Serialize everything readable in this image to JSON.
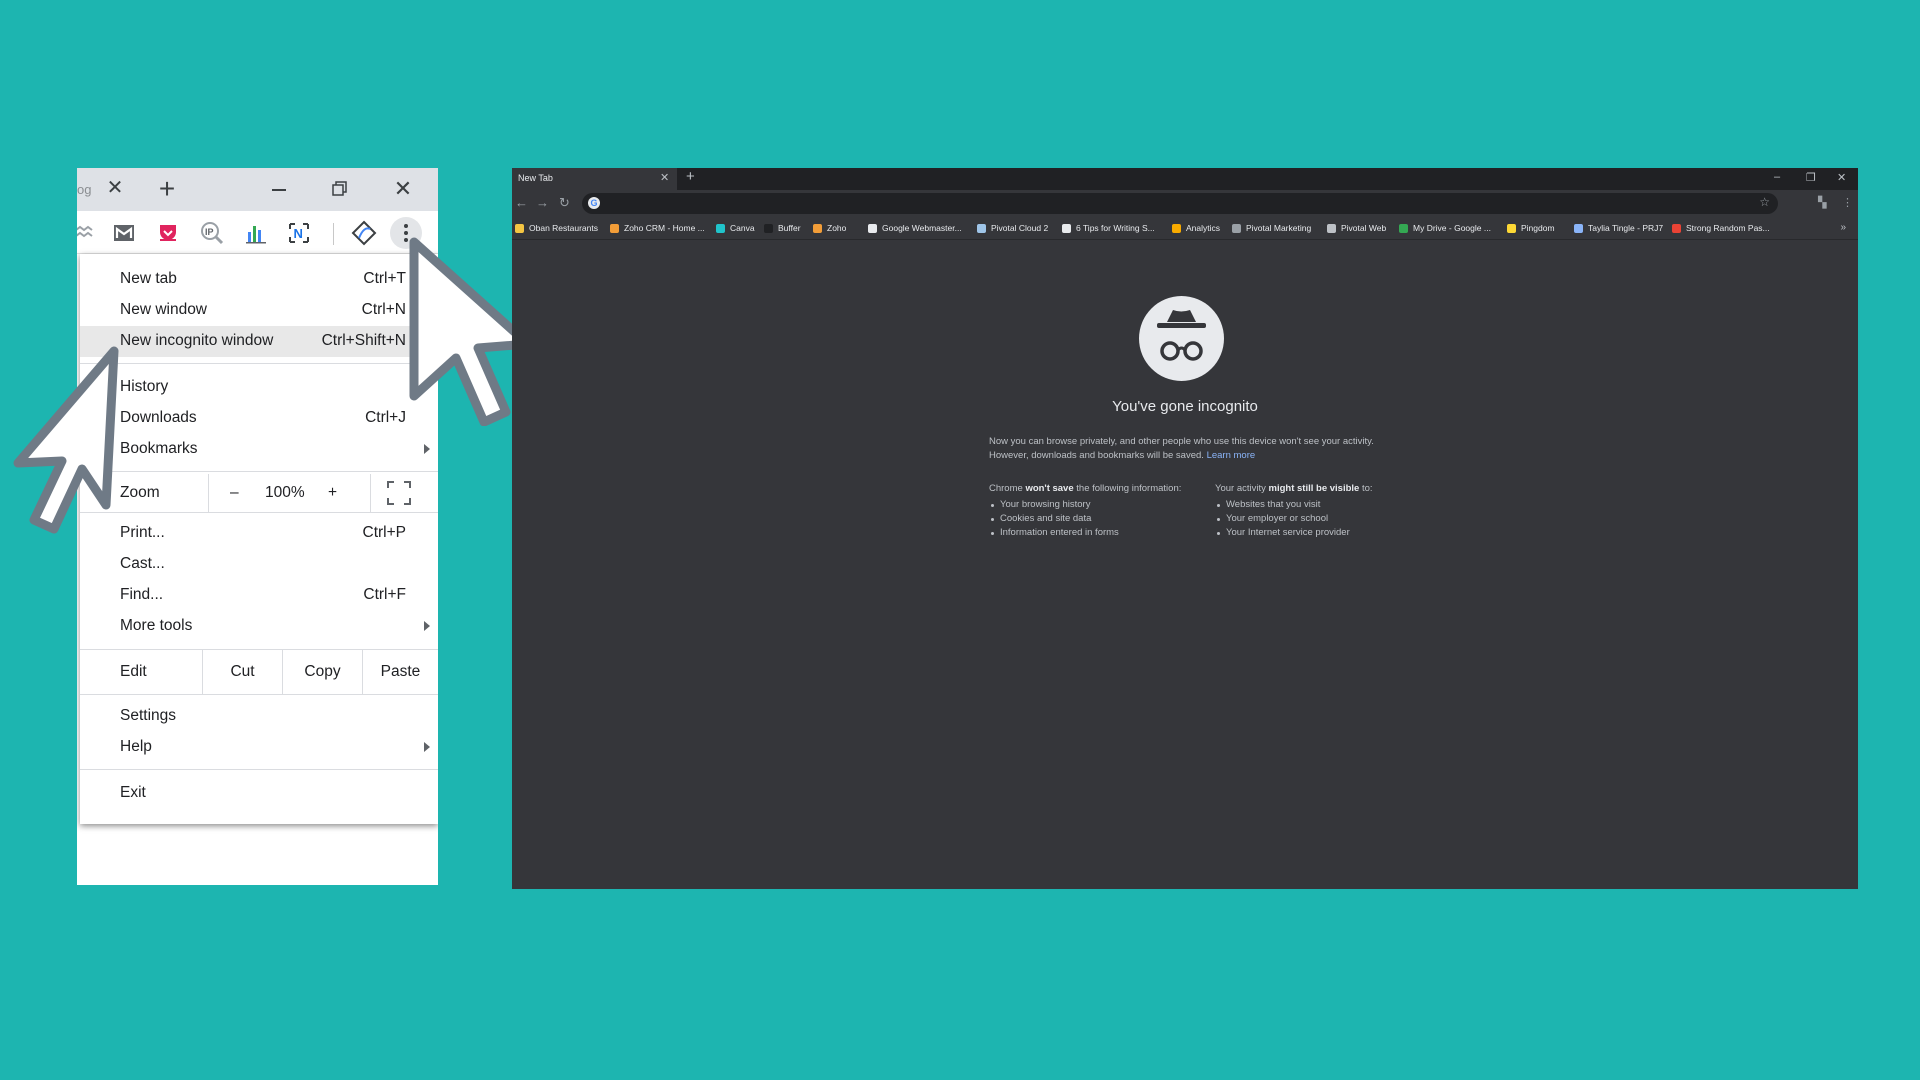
{
  "colors": {
    "background": "#1db5b0",
    "incognito_bg": "#35363a",
    "menu_bg": "#ffffff",
    "link": "#8ab4f8"
  },
  "left": {
    "tab_fragment": "og",
    "extensions": [
      "bookmarks-sync-icon",
      "gmail-icon",
      "pocket-icon",
      "ip-lookup-icon",
      "analytics-chart-icon",
      "notion-n-icon",
      "theme-extension-icon"
    ],
    "menu": {
      "new_tab": {
        "label": "New tab",
        "shortcut": "Ctrl+T"
      },
      "new_window": {
        "label": "New window",
        "shortcut": "Ctrl+N"
      },
      "new_incognito": {
        "label": "New incognito window",
        "shortcut": "Ctrl+Shift+N"
      },
      "history": {
        "label": "History"
      },
      "downloads": {
        "label": "Downloads",
        "shortcut": "Ctrl+J"
      },
      "bookmarks": {
        "label": "Bookmarks"
      },
      "zoom": {
        "label": "Zoom",
        "minus": "–",
        "value": "100%",
        "plus": "+"
      },
      "print": {
        "label": "Print...",
        "shortcut": "Ctrl+P"
      },
      "cast": {
        "label": "Cast..."
      },
      "find": {
        "label": "Find...",
        "shortcut": "Ctrl+F"
      },
      "more_tools": {
        "label": "More tools"
      },
      "edit": {
        "label": "Edit",
        "cut": "Cut",
        "copy": "Copy",
        "paste": "Paste"
      },
      "settings": {
        "label": "Settings"
      },
      "help": {
        "label": "Help"
      },
      "exit": {
        "label": "Exit"
      }
    }
  },
  "right": {
    "tab_title": "New Tab",
    "bookmarks": [
      {
        "label": "Oban Restaurants",
        "color": "#f4c542"
      },
      {
        "label": "Zoho CRM - Home ...",
        "color": "#f29d38"
      },
      {
        "label": "Canva",
        "color": "#20c4cb"
      },
      {
        "label": "Buffer",
        "color": "#202124"
      },
      {
        "label": "Zoho",
        "color": "#f29d38"
      },
      {
        "label": "Google Webmaster...",
        "color": "#e8eaed"
      },
      {
        "label": "Pivotal Cloud 2",
        "color": "#9fc5e8"
      },
      {
        "label": "6 Tips for Writing S...",
        "color": "#e8eaed"
      },
      {
        "label": "Analytics",
        "color": "#f9ab00"
      },
      {
        "label": "Pivotal Marketing",
        "color": "#9aa0a6"
      },
      {
        "label": "Pivotal Web",
        "color": "#bdc1c6"
      },
      {
        "label": "My Drive - Google ...",
        "color": "#34a853"
      },
      {
        "label": "Pingdom",
        "color": "#fdd835"
      },
      {
        "label": "Taylia Tingle - PRJ7",
        "color": "#8ab4f8"
      },
      {
        "label": "Strong Random Pas...",
        "color": "#ea4335"
      }
    ],
    "incognito": {
      "title": "You've gone incognito",
      "paragraph": "Now you can browse privately, and other people who use this device won't see your activity. However, downloads and bookmarks will be saved.",
      "learn_more": "Learn more",
      "left_col": {
        "pre": "Chrome ",
        "bold": "won't save",
        "post": " the following information:",
        "items": [
          "Your browsing history",
          "Cookies and site data",
          "Information entered in forms"
        ]
      },
      "right_col": {
        "pre": "Your activity ",
        "bold": "might still be visible",
        "post": " to:",
        "items": [
          "Websites that you visit",
          "Your employer or school",
          "Your Internet service provider"
        ]
      }
    }
  }
}
